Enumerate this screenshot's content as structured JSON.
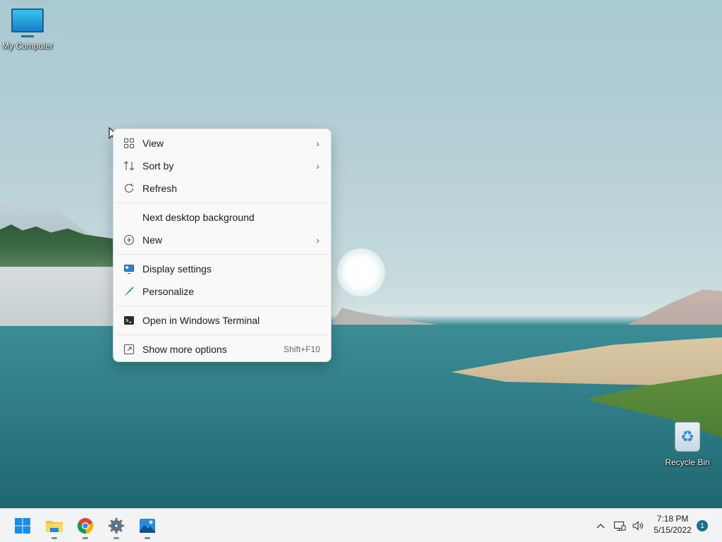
{
  "desktop": {
    "icons": [
      {
        "label": "My Computer",
        "icon": "monitor-icon"
      },
      {
        "label": "Recycle Bin",
        "icon": "recycle-bin-icon"
      }
    ]
  },
  "context_menu": {
    "items": [
      {
        "label": "View",
        "icon": "grid-icon",
        "submenu": true
      },
      {
        "label": "Sort by",
        "icon": "sort-arrows-icon",
        "submenu": true
      },
      {
        "label": "Refresh",
        "icon": "refresh-icon"
      },
      {
        "label": "Next desktop background"
      },
      {
        "label": "New",
        "icon": "plus-circle-icon",
        "submenu": true
      },
      {
        "label": "Display settings",
        "icon": "display-settings-icon"
      },
      {
        "label": "Personalize",
        "icon": "brush-icon"
      },
      {
        "label": "Open in Windows Terminal",
        "icon": "terminal-icon"
      },
      {
        "label": "Show more options",
        "icon": "show-more-icon",
        "shortcut": "Shift+F10"
      }
    ],
    "submenu_glyph": "›"
  },
  "taskbar": {
    "apps": [
      {
        "name": "start-button",
        "icon": "windows-logo-icon"
      },
      {
        "name": "file-explorer",
        "icon": "folder-icon"
      },
      {
        "name": "chrome",
        "icon": "chrome-icon"
      },
      {
        "name": "settings",
        "icon": "gear-icon"
      },
      {
        "name": "photos",
        "icon": "photos-icon"
      }
    ],
    "tray": {
      "overflow_glyph": "^",
      "time": "7:18 PM",
      "date": "5/15/2022",
      "notification_count": "1"
    }
  }
}
